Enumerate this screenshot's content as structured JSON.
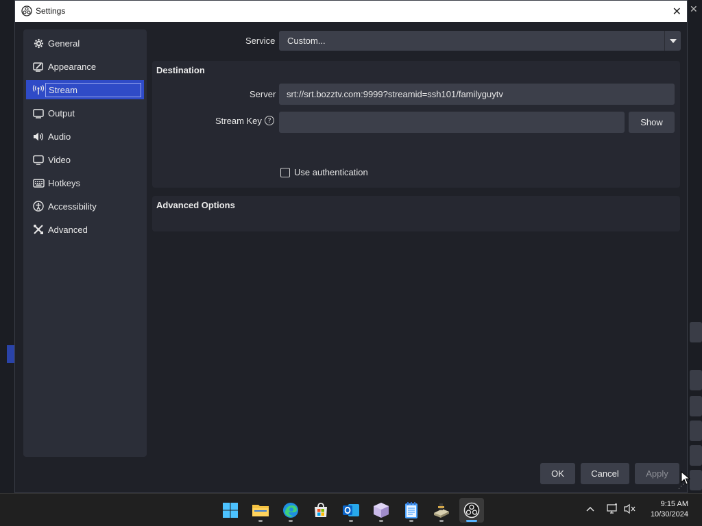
{
  "window": {
    "title": "Settings"
  },
  "sidebar": {
    "items": [
      {
        "label": "General",
        "icon": "gear-icon"
      },
      {
        "label": "Appearance",
        "icon": "appearance-icon"
      },
      {
        "label": "Stream",
        "icon": "antenna-icon",
        "active": true
      },
      {
        "label": "Output",
        "icon": "output-icon"
      },
      {
        "label": "Audio",
        "icon": "speaker-icon"
      },
      {
        "label": "Video",
        "icon": "monitor-icon"
      },
      {
        "label": "Hotkeys",
        "icon": "keyboard-icon"
      },
      {
        "label": "Accessibility",
        "icon": "accessibility-icon"
      },
      {
        "label": "Advanced",
        "icon": "tools-icon"
      }
    ]
  },
  "service": {
    "label": "Service",
    "value": "Custom..."
  },
  "destination": {
    "title": "Destination",
    "server_label": "Server",
    "server_value": "srt://srt.bozztv.com:9999?streamid=ssh101/familyguytv",
    "stream_key_label": "Stream Key",
    "stream_key_value": "",
    "show_label": "Show",
    "use_auth_label": "Use authentication",
    "use_auth_checked": false
  },
  "advanced": {
    "title": "Advanced Options"
  },
  "footer": {
    "ok_label": "OK",
    "cancel_label": "Cancel",
    "apply_label": "Apply"
  },
  "taskbar": {
    "apps": [
      "windows-start-icon",
      "file-explorer-icon",
      "edge-browser-icon",
      "microsoft-store-icon",
      "outlook-icon",
      "package-icon",
      "notepad-icon",
      "settings-tool-icon",
      "obs-icon"
    ],
    "time": "9:15 AM",
    "date": "10/30/2024"
  },
  "colors": {
    "accent": "#2f4bc7",
    "dialog_bg": "#1f2128",
    "panel_bg": "#2b2e38",
    "field_bg": "#3c3f4a"
  }
}
